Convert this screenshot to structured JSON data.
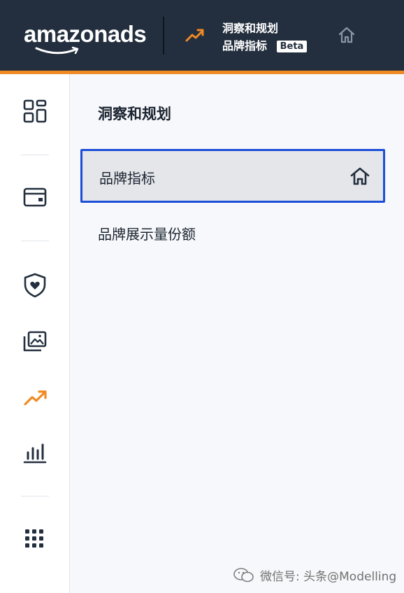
{
  "header": {
    "logo_text": "amazonads",
    "breadcrumb_section": "洞察和规划",
    "breadcrumb_page": "品牌指标",
    "beta_badge": "Beta",
    "accent_color": "#f08a24",
    "bg_color": "#232f3e"
  },
  "sidebar": {
    "icons": [
      "dashboard-grid-icon",
      "wallet-icon",
      "heart-shield-icon",
      "image-gallery-icon",
      "trending-up-icon",
      "bar-chart-icon",
      "apps-grid-icon"
    ],
    "active": "trending-up-icon"
  },
  "panel": {
    "title": "洞察和规划",
    "items": [
      {
        "label": "品牌指标",
        "selected": true,
        "icon": "home-icon"
      },
      {
        "label": "品牌展示量份额",
        "selected": false
      }
    ],
    "selected_border_color": "#1d4ed8"
  },
  "watermark": {
    "text": "微信号: 头条@Modelling"
  }
}
